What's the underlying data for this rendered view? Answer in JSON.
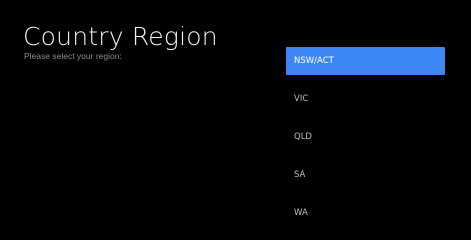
{
  "header": {
    "title": "Country Region",
    "subtitle": "Please select your region:"
  },
  "regions": {
    "selected_index": 0,
    "items": [
      {
        "label": "NSW/ACT"
      },
      {
        "label": "VIC"
      },
      {
        "label": "QLD"
      },
      {
        "label": "SA"
      },
      {
        "label": "WA"
      }
    ]
  },
  "colors": {
    "background": "#000000",
    "selected": "#3d86f6",
    "text": "#bdbdbd"
  }
}
